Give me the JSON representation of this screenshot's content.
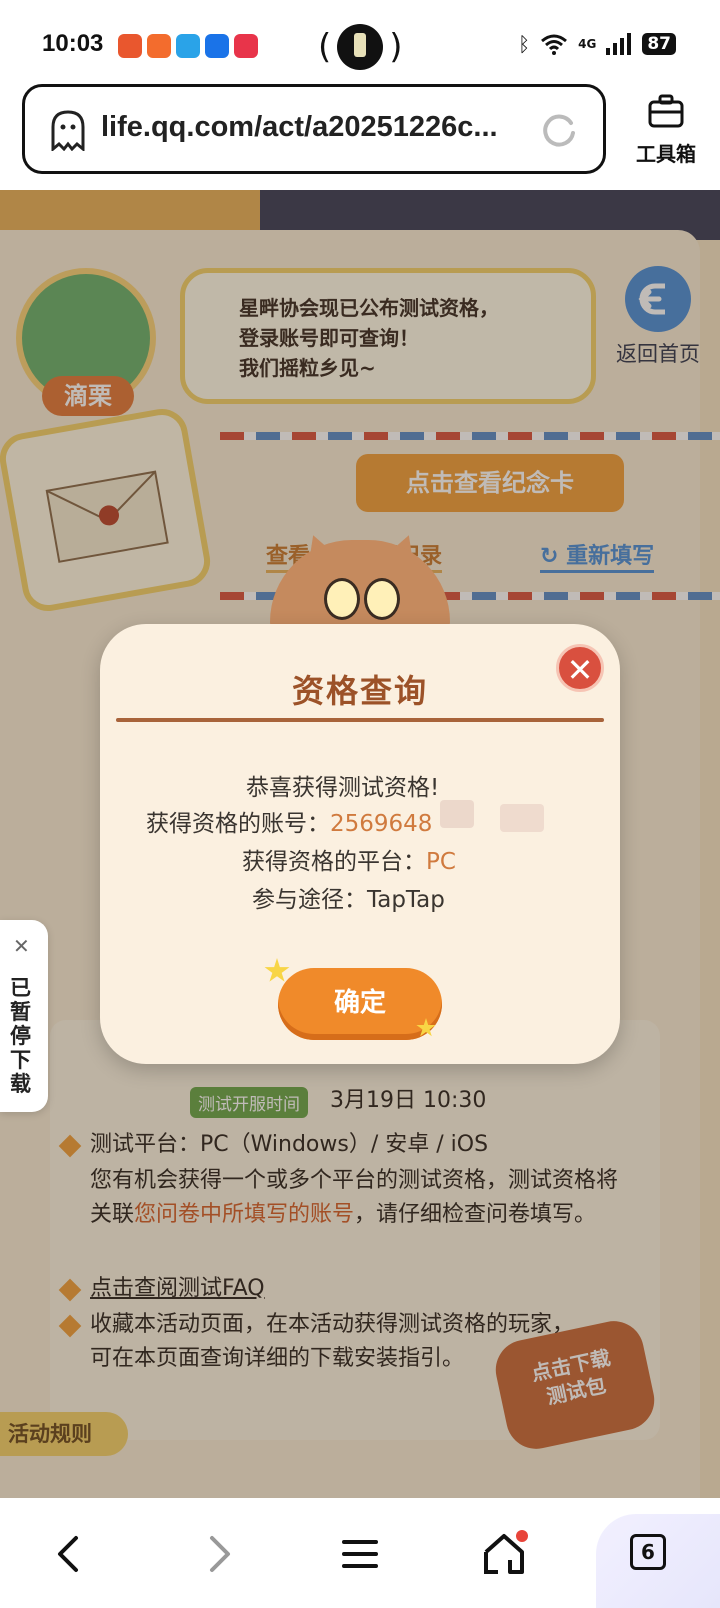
{
  "status_bar": {
    "time": "10:03",
    "center_text_left": "(",
    "center_text_right": ")",
    "network": "4G",
    "battery": "87"
  },
  "url_bar": {
    "url": "life.qq.com/act/a20251226c..."
  },
  "toolbox": {
    "label": "工具箱"
  },
  "page": {
    "avatar_name": "滴栗",
    "speech_lines": [
      "星畔协会现已公布测试资格，",
      "登录账号即可查询！",
      "我们摇粒乡见~"
    ],
    "back_home": "返回首页",
    "memorial_card_button": "点击查看纪念卡",
    "view_record_link": "查看问卷填写记录",
    "refill_link": "重新填写",
    "server_time_pill": "测试开服时间",
    "server_time": "3月19日  10:30",
    "rules": {
      "platform": "测试平台：PC（Windows）/ 安卓 / iOS",
      "desc_part1": "您有机会获得一个或多个平台的测试资格，测试资格将关联",
      "desc_highlight": "您问卷中所填写的账号",
      "desc_part2": "，请仔细检查问卷填写。",
      "faq": "点击查阅测试FAQ",
      "bookmark": "收藏本活动页面，在本活动获得测试资格的玩家，可在本页面查询详细的下载安装指引。"
    },
    "download_badge_line1": "点击下载",
    "download_badge_line2": "测试包",
    "rules_tab": "活动规则"
  },
  "paused_download": {
    "label": "已暂停下载"
  },
  "modal": {
    "title": "资格查询",
    "congrats": "恭喜获得测试资格!",
    "account_label": "获得资格的账号：",
    "account_value": "2569648",
    "platform_label": "获得资格的平台：",
    "platform_value": "PC",
    "channel_label": "参与途径：",
    "channel_value": "TapTap",
    "confirm": "确定"
  },
  "nav": {
    "tab_count": "6"
  },
  "colors": {
    "accent_orange": "#f08a2a",
    "title_brown": "#9c5228",
    "value_orange": "#d07a3e",
    "close_red": "#d9503f"
  }
}
